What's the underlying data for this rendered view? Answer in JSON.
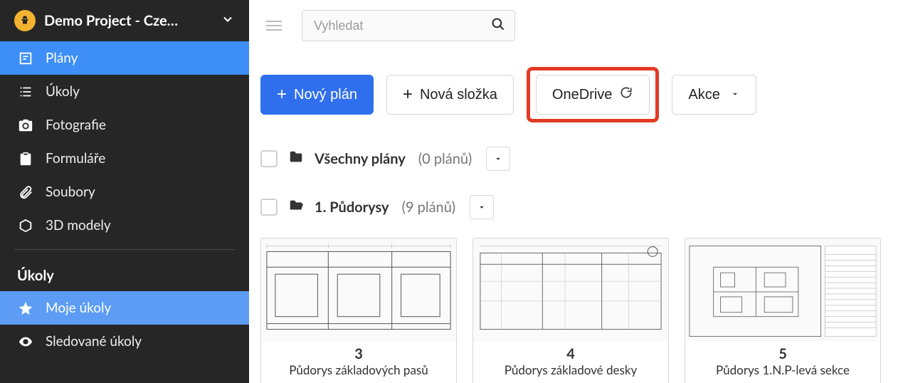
{
  "project": {
    "title": "Demo Project - Cze…"
  },
  "sidebar": {
    "items": [
      {
        "label": "Plány"
      },
      {
        "label": "Úkoly"
      },
      {
        "label": "Fotografie"
      },
      {
        "label": "Formuláře"
      },
      {
        "label": "Soubory"
      },
      {
        "label": "3D modely"
      }
    ],
    "section_label": "Úkoly",
    "sub_items": [
      {
        "label": "Moje úkoly"
      },
      {
        "label": "Sledované úkoly"
      }
    ]
  },
  "search": {
    "placeholder": "Vyhledat"
  },
  "toolbar": {
    "new_plan": "Nový plán",
    "new_folder": "Nová složka",
    "onedrive": "OneDrive",
    "actions": "Akce"
  },
  "folders": [
    {
      "name": "Všechny plány",
      "count": "(0 plánů)"
    },
    {
      "name": "1. Půdorysy",
      "count": "(9 plánů)"
    }
  ],
  "cards": [
    {
      "num": "3",
      "name": "Půdorys základových pasů"
    },
    {
      "num": "4",
      "name": "Půdorys základové desky"
    },
    {
      "num": "5",
      "name": "Půdorys 1.N.P-levá sekce"
    }
  ]
}
